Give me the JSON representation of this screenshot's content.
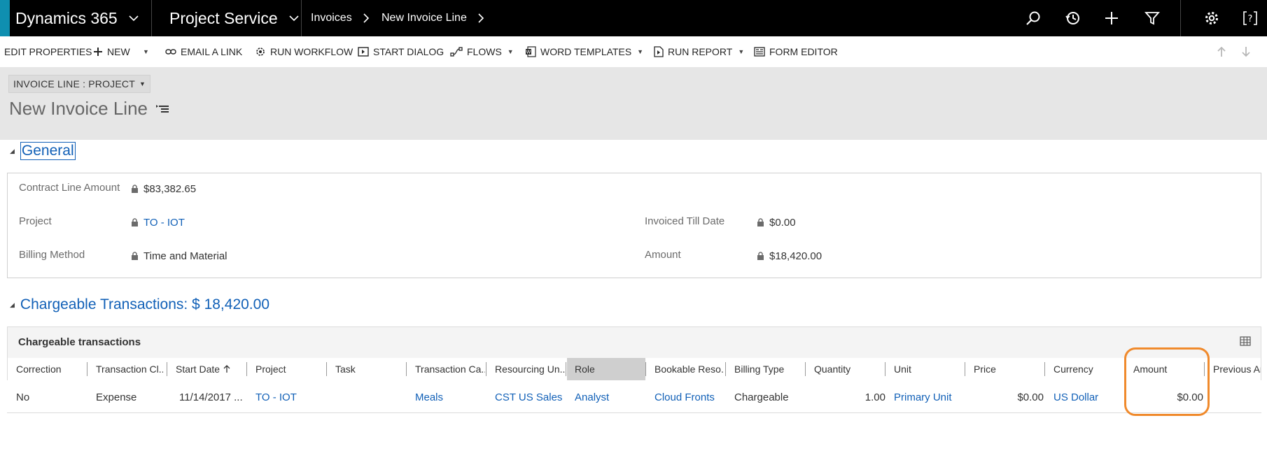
{
  "topnav": {
    "app_name": "Dynamics 365",
    "area_name": "Project Service",
    "breadcrumb": [
      "Invoices",
      "New Invoice Line"
    ],
    "icons": [
      "search-icon",
      "history-icon",
      "plus-icon",
      "filter-icon",
      "gear-icon",
      "help-icon"
    ]
  },
  "commandbar": {
    "edit_properties": "EDIT PROPERTIES",
    "new": "NEW",
    "email_link": "EMAIL A LINK",
    "run_workflow": "RUN WORKFLOW",
    "start_dialog": "START DIALOG",
    "flows": "FLOWS",
    "word_templates": "WORD TEMPLATES",
    "run_report": "RUN REPORT",
    "form_editor": "FORM EDITOR"
  },
  "header": {
    "form_selector": "INVOICE LINE : PROJECT",
    "record_title": "New Invoice Line"
  },
  "general": {
    "title": "General",
    "fields": {
      "contract_line_amount_label": "Contract Line Amount",
      "contract_line_amount_value": "$83,382.65",
      "project_label": "Project",
      "project_value": "TO - IOT",
      "billing_method_label": "Billing Method",
      "billing_method_value": "Time and Material",
      "invoiced_till_date_label": "Invoiced Till Date",
      "invoiced_till_date_value": "$0.00",
      "amount_label": "Amount",
      "amount_value": "$18,420.00"
    }
  },
  "chargeable": {
    "section_title": "Chargeable Transactions: $ 18,420.00",
    "grid_title": "Chargeable transactions",
    "columns": [
      "Correction",
      "Transaction Cl...",
      "Start Date",
      "Project",
      "Task",
      "Transaction Ca...",
      "Resourcing Un...",
      "Role",
      "Bookable Reso...",
      "Billing Type",
      "Quantity",
      "Unit",
      "Price",
      "Currency",
      "Amount",
      "Previous Ar"
    ],
    "row": {
      "correction": "No",
      "transaction_class": "Expense",
      "start_date": "11/14/2017 ...",
      "project": "TO - IOT",
      "task": "",
      "transaction_category": "Meals",
      "resourcing_unit": "CST US Sales",
      "role": "Analyst",
      "bookable_resource": "Cloud Fronts",
      "billing_type": "Chargeable",
      "quantity": "1.00",
      "unit": "Primary Unit",
      "price": "$0.00",
      "currency": "US Dollar",
      "amount": "$0.00"
    }
  },
  "colors": {
    "link": "#1160b7",
    "highlight": "#f08a2c",
    "accent": "#0f8fb0"
  }
}
